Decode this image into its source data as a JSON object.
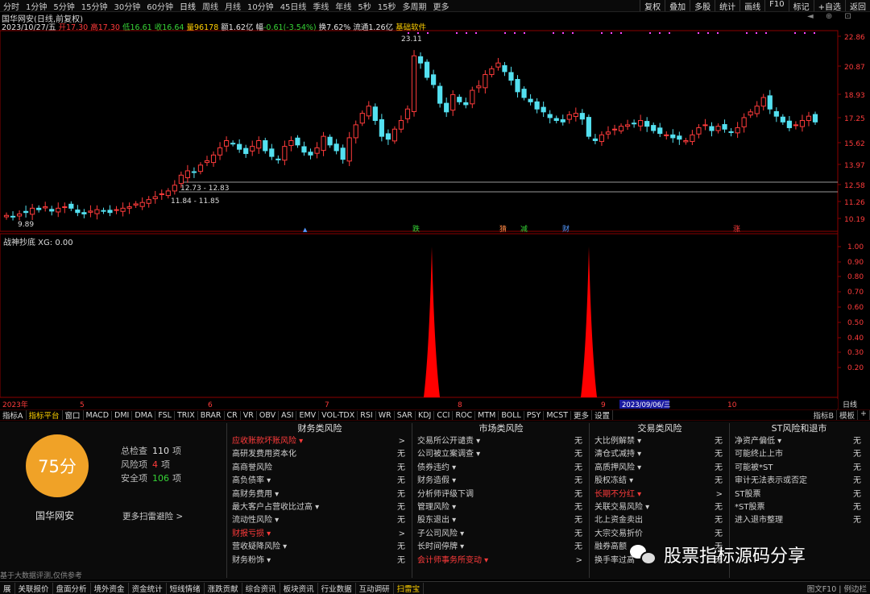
{
  "topbar": {
    "periods": [
      "分时",
      "1分钟",
      "5分钟",
      "15分钟",
      "30分钟",
      "60分钟",
      "日线",
      "周线",
      "月线",
      "10分钟",
      "45日线",
      "季线",
      "年线",
      "5秒",
      "15秒",
      "多周期",
      "更多"
    ],
    "active": "日线",
    "right": [
      "复权",
      "叠加",
      "多股",
      "统计",
      "画线",
      "F10",
      "标记",
      "+自选",
      "返回"
    ]
  },
  "header": {
    "name": "国华网安(日线,前复权)",
    "date": "2023/10/27/五",
    "open_label": "开",
    "open": "17.30",
    "high_label": "高",
    "high": "17.30",
    "low_label": "低",
    "low": "16.61",
    "close_label": "收",
    "close": "16.64",
    "vol_label": "量",
    "vol": "96178",
    "amt_label": "额",
    "amt": "1.62亿",
    "chg_label": "幅",
    "chg": "-0.61(-3.54%)",
    "turn_label": "换",
    "turn": "7.62%",
    "float_label": "流通",
    "float": "1.26亿",
    "soft": "基础软件"
  },
  "chart_data": {
    "type": "candlestick",
    "y_ticks": [
      "22.86",
      "20.87",
      "18.93",
      "17.25",
      "15.62",
      "13.97",
      "12.58",
      "11.26",
      "10.19"
    ],
    "annotations": [
      "23.11",
      "12.73 - 12.83",
      "11.84 - 11.85",
      "9.89"
    ],
    "event_marks": [
      "跌",
      "猜",
      "减",
      "财",
      "涨"
    ],
    "x_labels": [
      "2023年",
      "5",
      "6",
      "7",
      "8",
      "9",
      "2023/09/06/三",
      "10"
    ],
    "indicator": {
      "title": "战神抄底 XG: 0.00",
      "y_ticks": [
        "1.00",
        "0.90",
        "0.80",
        "0.70",
        "0.60",
        "0.50",
        "0.40",
        "0.30",
        "0.20"
      ],
      "signals": [
        1.0,
        1.0
      ]
    }
  },
  "indicator_tabs": [
    "指标A",
    "指标平台",
    "窗口",
    "MACD",
    "DMI",
    "DMA",
    "FSL",
    "TRIX",
    "BRAR",
    "CR",
    "VR",
    "OBV",
    "ASI",
    "EMV",
    "VOL-TDX",
    "RSI",
    "WR",
    "SAR",
    "KDJ",
    "CCI",
    "ROC",
    "MTM",
    "BOLL",
    "PSY",
    "MCST",
    "更多",
    "设置"
  ],
  "indicator_tabs_active": "指标平台",
  "indicator_tabs_right": [
    "指标B",
    "模板",
    "+"
  ],
  "panel": {
    "score": "75分",
    "stock_name": "国华网安",
    "stats": [
      {
        "label": "总检查",
        "value": "110",
        "unit": "项",
        "color": "#e0e0e0"
      },
      {
        "label": "风险项",
        "value": "4",
        "unit": "项",
        "color": "#ff3b3b"
      },
      {
        "label": "安全项",
        "value": "106",
        "unit": "项",
        "color": "#36d436"
      }
    ],
    "more": "更多扫雷避险 >",
    "disclaimer": "基于大数据评测,仅供参考",
    "columns": [
      {
        "title": "财务类风险",
        "rows": [
          {
            "name": "应收账款坏账风险 ▾",
            "value": ">",
            "hl": true
          },
          {
            "name": "高研发费用资本化",
            "value": "无"
          },
          {
            "name": "高商誉风险",
            "value": "无"
          },
          {
            "name": "高负债率 ▾",
            "value": "无"
          },
          {
            "name": "高财务费用 ▾",
            "value": "无"
          },
          {
            "name": "最大客户占营收比过高 ▾",
            "value": "无"
          },
          {
            "name": "流动性风险 ▾",
            "value": "无"
          },
          {
            "name": "财报亏损 ▾",
            "value": ">",
            "hl": true
          },
          {
            "name": "营收疑降风险 ▾",
            "value": "无"
          },
          {
            "name": "财务粉饰 ▾",
            "value": "无"
          }
        ]
      },
      {
        "title": "市场类风险",
        "rows": [
          {
            "name": "交易所公开谴责 ▾",
            "value": "无"
          },
          {
            "name": "公司被立案调查 ▾",
            "value": "无"
          },
          {
            "name": "债券违约 ▾",
            "value": "无"
          },
          {
            "name": "财务造假 ▾",
            "value": "无"
          },
          {
            "name": "分析师评级下调",
            "value": "无"
          },
          {
            "name": "管理风险 ▾",
            "value": "无"
          },
          {
            "name": "股东退出 ▾",
            "value": "无"
          },
          {
            "name": "子公司风险 ▾",
            "value": "无"
          },
          {
            "name": "长时间停牌 ▾",
            "value": "无"
          },
          {
            "name": "会计师事务所变动 ▾",
            "value": ">",
            "hl": true
          }
        ]
      },
      {
        "title": "交易类风险",
        "rows": [
          {
            "name": "大比例解禁 ▾",
            "value": "无"
          },
          {
            "name": "清仓式减持 ▾",
            "value": "无"
          },
          {
            "name": "高质押风险 ▾",
            "value": "无"
          },
          {
            "name": "股权冻结 ▾",
            "value": "无"
          },
          {
            "name": "长期不分红 ▾",
            "value": ">",
            "hl": true
          },
          {
            "name": "关联交易风险 ▾",
            "value": "无"
          },
          {
            "name": "北上资金卖出",
            "value": "无"
          },
          {
            "name": "大宗交易折价",
            "value": "无"
          },
          {
            "name": "融券高额",
            "value": "无"
          },
          {
            "name": "换手率过高",
            "value": "无"
          }
        ]
      },
      {
        "title": "ST风险和退市",
        "rows": [
          {
            "name": "净资产偏低 ▾",
            "value": "无"
          },
          {
            "name": "可能终止上市",
            "value": "无"
          },
          {
            "name": "可能被*ST",
            "value": "无"
          },
          {
            "name": "审计无法表示或否定",
            "value": "无"
          },
          {
            "name": "ST股票",
            "value": "无"
          },
          {
            "name": "*ST股票",
            "value": "无"
          },
          {
            "name": "进入退市整理",
            "value": "无"
          }
        ]
      }
    ]
  },
  "bottombar": {
    "items": [
      "展",
      "关联报价",
      "盘面分析",
      "境外资金",
      "资金统计",
      "短线情绪",
      "涨跌贡献",
      "综合资讯",
      "板块资讯",
      "行业数据",
      "互动调研",
      "扫雷宝"
    ],
    "active": "扫雷宝",
    "right": "图文F10 | 例边栏"
  },
  "watermark": "股票指标源码分享"
}
